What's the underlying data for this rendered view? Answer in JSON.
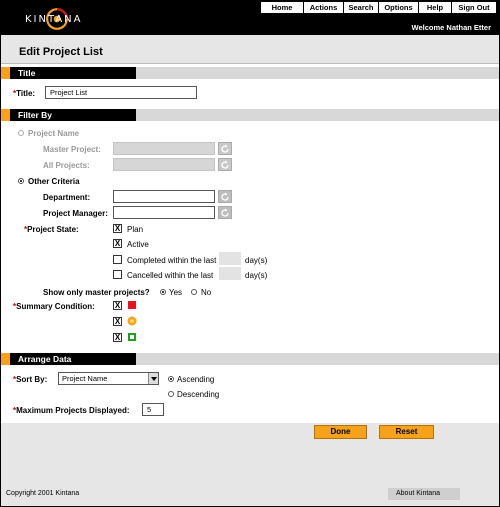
{
  "header": {
    "logo_text": "KINTANA",
    "nav": [
      "Home",
      "Actions",
      "Search",
      "Options",
      "Help",
      "Sign Out"
    ],
    "welcome": "Welcome Nathan Etter"
  },
  "page": {
    "title": "Edit Project List"
  },
  "title_section": {
    "header": "Title",
    "asterisk": "*",
    "label": "Title:",
    "value": "Project List"
  },
  "filter_section": {
    "header": "Filter By",
    "project_name_option": "Project Name",
    "master_project_label": "Master Project:",
    "all_projects_label": "All Projects:",
    "other_criteria_option": "Other Criteria",
    "department_label": "Department:",
    "project_manager_label": "Project Manager:",
    "asterisk": "*",
    "project_state_label": "Project State:",
    "states": [
      {
        "label": "Plan",
        "checked": true
      },
      {
        "label": "Active",
        "checked": true
      },
      {
        "label": "Completed within the last",
        "checked": false,
        "suffix": "day(s)"
      },
      {
        "label": "Cancelled within the last",
        "checked": false,
        "suffix": "day(s)"
      }
    ],
    "show_master_label": "Show only master projects?",
    "yes_label": "Yes",
    "no_label": "No",
    "summary_label": "Summary Condition:",
    "summary_conditions": [
      {
        "color": "#e8141c",
        "checked": true
      },
      {
        "color": "#f7a21b",
        "checked": true
      },
      {
        "color": "#1aa31a",
        "checked": true
      }
    ],
    "check_mark": "X"
  },
  "arrange_section": {
    "header": "Arrange Data",
    "asterisk": "*",
    "sort_by_label": "Sort By:",
    "sort_by_value": "Project Name",
    "ascending_label": "Ascending",
    "descending_label": "Descending",
    "max_label": "Maximum Projects Displayed:",
    "max_value": "5"
  },
  "buttons": {
    "done": "Done",
    "reset": "Reset"
  },
  "footer": {
    "copyright": "Copyright 2001 Kintana",
    "about": "About Kintana"
  },
  "colors": {
    "accent": "#f7a21b",
    "header_bg": "#000000"
  }
}
